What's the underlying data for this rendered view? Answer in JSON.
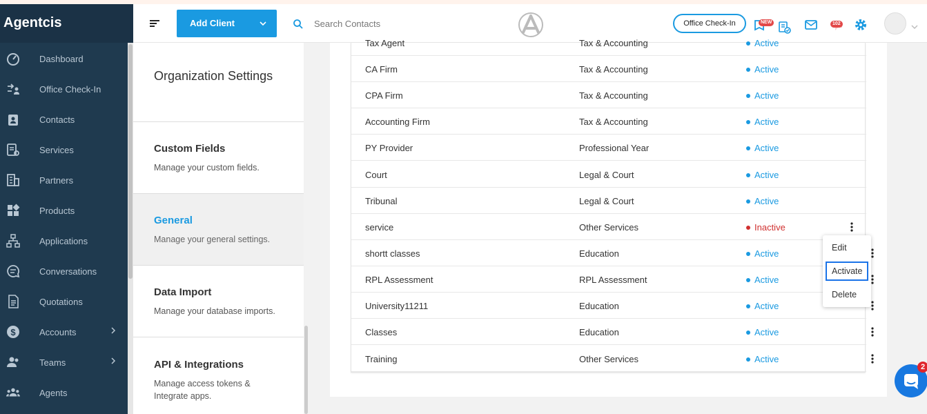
{
  "app": {
    "brand": "Agentcis"
  },
  "sidebar": {
    "items": [
      {
        "label": "Dashboard",
        "icon": "dashboard-icon"
      },
      {
        "label": "Office Check-In",
        "icon": "check-in-icon"
      },
      {
        "label": "Contacts",
        "icon": "contacts-icon"
      },
      {
        "label": "Services",
        "icon": "services-icon"
      },
      {
        "label": "Partners",
        "icon": "partners-icon"
      },
      {
        "label": "Products",
        "icon": "products-icon"
      },
      {
        "label": "Applications",
        "icon": "applications-icon"
      },
      {
        "label": "Conversations",
        "icon": "conversations-icon"
      },
      {
        "label": "Quotations",
        "icon": "quotations-icon"
      },
      {
        "label": "Accounts",
        "icon": "accounts-icon",
        "expandable": true
      },
      {
        "label": "Teams",
        "icon": "teams-icon",
        "expandable": true
      },
      {
        "label": "Agents",
        "icon": "agents-icon"
      }
    ]
  },
  "header": {
    "add_client_label": "Add Client",
    "search_placeholder": "Search Contacts",
    "office_checkin_label": "Office Check-In",
    "new_badge": "NEW",
    "notification_count": "102"
  },
  "settings": {
    "title": "Organization Settings",
    "items": [
      {
        "title": "Custom Fields",
        "desc": "Manage your custom fields."
      },
      {
        "title": "General",
        "desc": "Manage your general settings.",
        "active": true
      },
      {
        "title": "Data Import",
        "desc": "Manage your database imports."
      },
      {
        "title": "API & Integrations",
        "desc": "Manage access tokens & Integrate apps."
      }
    ]
  },
  "table": {
    "rows": [
      {
        "name": "Tax Agent",
        "category": "Tax & Accounting",
        "status": "Active"
      },
      {
        "name": "CA Firm",
        "category": "Tax & Accounting",
        "status": "Active"
      },
      {
        "name": "CPA Firm",
        "category": "Tax & Accounting",
        "status": "Active"
      },
      {
        "name": "Accounting Firm",
        "category": "Tax & Accounting",
        "status": "Active"
      },
      {
        "name": "PY Provider",
        "category": "Professional Year",
        "status": "Active"
      },
      {
        "name": "Court",
        "category": "Legal & Court",
        "status": "Active"
      },
      {
        "name": "Tribunal",
        "category": "Legal & Court",
        "status": "Active"
      },
      {
        "name": "service",
        "category": "Other Services",
        "status": "Inactive"
      },
      {
        "name": "shortt classes",
        "category": "Education",
        "status": "Active"
      },
      {
        "name": "RPL Assessment",
        "category": "RPL Assessment",
        "status": "Active"
      },
      {
        "name": "University11211",
        "category": "Education",
        "status": "Active"
      },
      {
        "name": "Classes",
        "category": "Education",
        "status": "Active"
      },
      {
        "name": "Training",
        "category": "Other Services",
        "status": "Active"
      }
    ]
  },
  "dropdown": {
    "options": [
      "Edit",
      "Activate",
      "Delete"
    ],
    "focused": "Activate"
  },
  "chat": {
    "badge": "2"
  },
  "colors": {
    "accent": "#1a9ae1",
    "sidebar": "#1f3a4f",
    "inactive": "#d0302f"
  }
}
